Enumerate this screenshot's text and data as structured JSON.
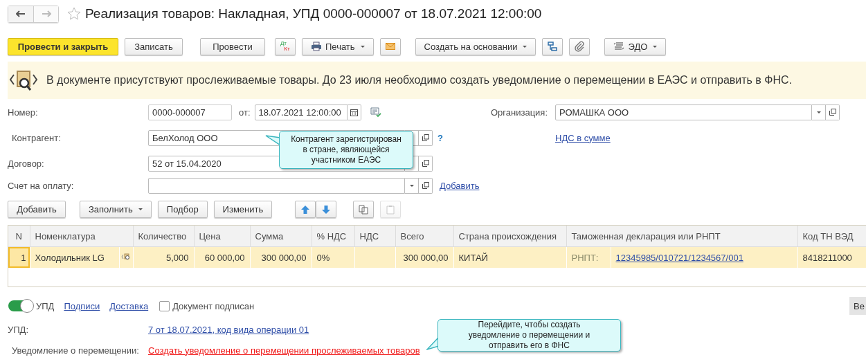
{
  "title": "Реализация товаров: Накладная, УПД 0000-000007 от 18.07.2021 12:00:00",
  "favorite": false,
  "toolbar": {
    "post_and_close": "Провести и закрыть",
    "save": "Записать",
    "post": "Провести",
    "dt": "Дт",
    "kt": "Кт",
    "print": "Печать",
    "create_based_on": "Создать на основании",
    "edo": "ЭДО"
  },
  "banner": "В документе присутствуют прослеживаемые товары. До 23 июля необходимо создать уведомление о перемещении в ЕАЭС и отправить в ФНС.",
  "form": {
    "number_label": "Номер:",
    "number": "0000-000007",
    "date_label": "от:",
    "date": "18.07.2021 12:00:00",
    "organization_label": "Организация:",
    "organization": "РОМАШКА ООО",
    "counterparty_label": "Контрагент:",
    "counterparty": "БелХолод ООО",
    "help": "?",
    "vat_link": "НДС в сумме",
    "contract_label": "Договор:",
    "contract": "52 от 15.04.2020",
    "invoice_label": "Счет на оплату:",
    "invoice_add": "Добавить"
  },
  "table_toolbar": {
    "add": "Добавить",
    "fill": "Заполнить",
    "pick": "Подбор",
    "edit": "Изменить",
    "paste_disabled": true
  },
  "table": {
    "columns": [
      "N",
      "Номенклатура",
      "Количество",
      "Цена",
      "Сумма",
      "% НДС",
      "НДС",
      "Всего",
      "Страна происхождения",
      "Таможенная декларация или РНПТ",
      "Код ТН ВЭД"
    ],
    "rows": [
      {
        "n": "1",
        "name": "Холодильник  LG",
        "quantity": "5,000",
        "price": "60 000,00",
        "sum": "300 000,00",
        "vat_rate": "0%",
        "total": "300 000,00",
        "country": "КИТАЙ",
        "declaration_label": "РНПТ:",
        "declaration": "12345985/010721/1234567/001",
        "tnved": "8418211000",
        "selected": true
      }
    ]
  },
  "footer": {
    "upd_toggle": {
      "label": "УПД",
      "on": true
    },
    "links": [
      "Подписи",
      "Доставка"
    ],
    "signed": {
      "label": "Документ подписан",
      "checked": false
    },
    "side_button": "Ве"
  },
  "upd": {
    "label": "УПД:",
    "link": "7 от 18.07.2021, код вида операции 01"
  },
  "notice": {
    "label": "Уведомление о перемещении:",
    "link": "Создать уведомление о перемещении прослеживаемых товаров"
  },
  "callouts": [
    "Контрагент зарегистрирован в стране, являющейся участником ЕАЭС",
    "Перейдите, чтобы создать уведомление о перемещении и отправить его в ФНС"
  ]
}
